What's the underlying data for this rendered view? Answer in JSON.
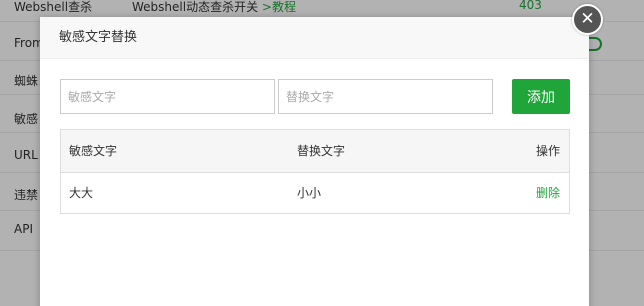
{
  "background": {
    "rows": [
      {
        "name": "Webshell查杀",
        "desc": "Webshell动态查杀开关",
        "link": ">教程",
        "status": "403"
      },
      {
        "name": "From",
        "desc": "",
        "link": "",
        "status": ""
      },
      {
        "name": "蜘蛛",
        "desc": "",
        "link": "",
        "status": ""
      },
      {
        "name": "敏感",
        "desc": "",
        "link": "",
        "status": ""
      },
      {
        "name": "URL",
        "desc": "",
        "link": "",
        "status": ""
      },
      {
        "name": "违禁",
        "desc": "",
        "link": "",
        "status": ""
      },
      {
        "name": "API",
        "desc": "",
        "link": "",
        "status": ""
      }
    ],
    "accent_color": "#20a53a"
  },
  "modal": {
    "title": "敏感文字替换",
    "close_icon": "close-icon",
    "sensitive_input": {
      "placeholder": "敏感文字",
      "value": ""
    },
    "replace_input": {
      "placeholder": "替换文字",
      "value": ""
    },
    "add_label": "添加",
    "table": {
      "headers": [
        "敏感文字",
        "替换文字",
        "操作"
      ],
      "rows": [
        {
          "sensitive": "大大",
          "replacement": "小小",
          "action": "删除"
        }
      ]
    }
  }
}
